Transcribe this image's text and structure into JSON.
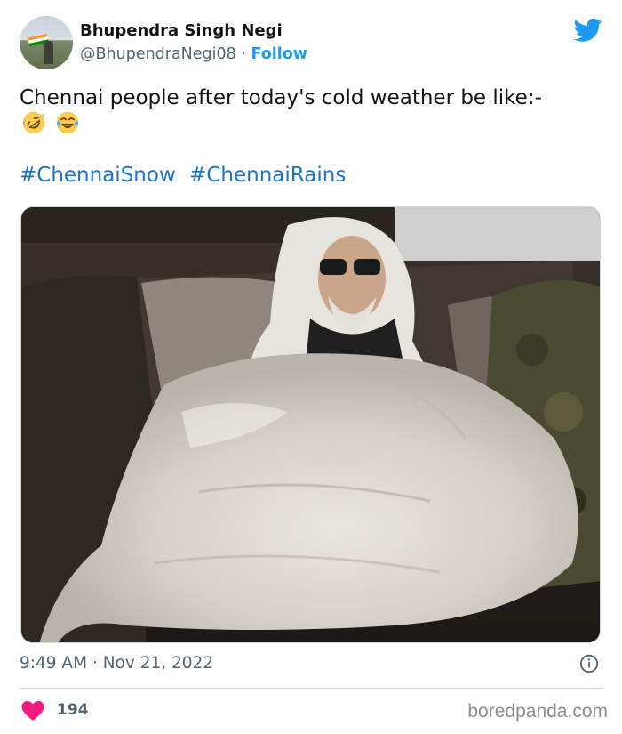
{
  "author": {
    "name": "Bhupendra Singh Negi",
    "handle": "@BhupendraNegi08",
    "separator": "·",
    "follow_label": "Follow"
  },
  "tweet": {
    "text": "Chennai people after today's cold weather be like:-",
    "emojis": [
      "rolling-on-floor-laughing-emoji",
      "face-with-tears-of-joy-emoji"
    ],
    "hashtags": [
      "#ChennaiSnow",
      "#ChennaiRains"
    ],
    "time": "9:49 AM",
    "date_separator": "·",
    "date": "Nov 21, 2022"
  },
  "engagement": {
    "likes": "194"
  },
  "watermark": "boredpanda.com",
  "colors": {
    "accent": "#1d9bf0",
    "hashtag": "#1b72c8",
    "heart": "#f91880",
    "muted": "#536471"
  },
  "icons": {
    "brand": "twitter-bird-icon",
    "info": "info-icon",
    "like": "heart-icon"
  }
}
